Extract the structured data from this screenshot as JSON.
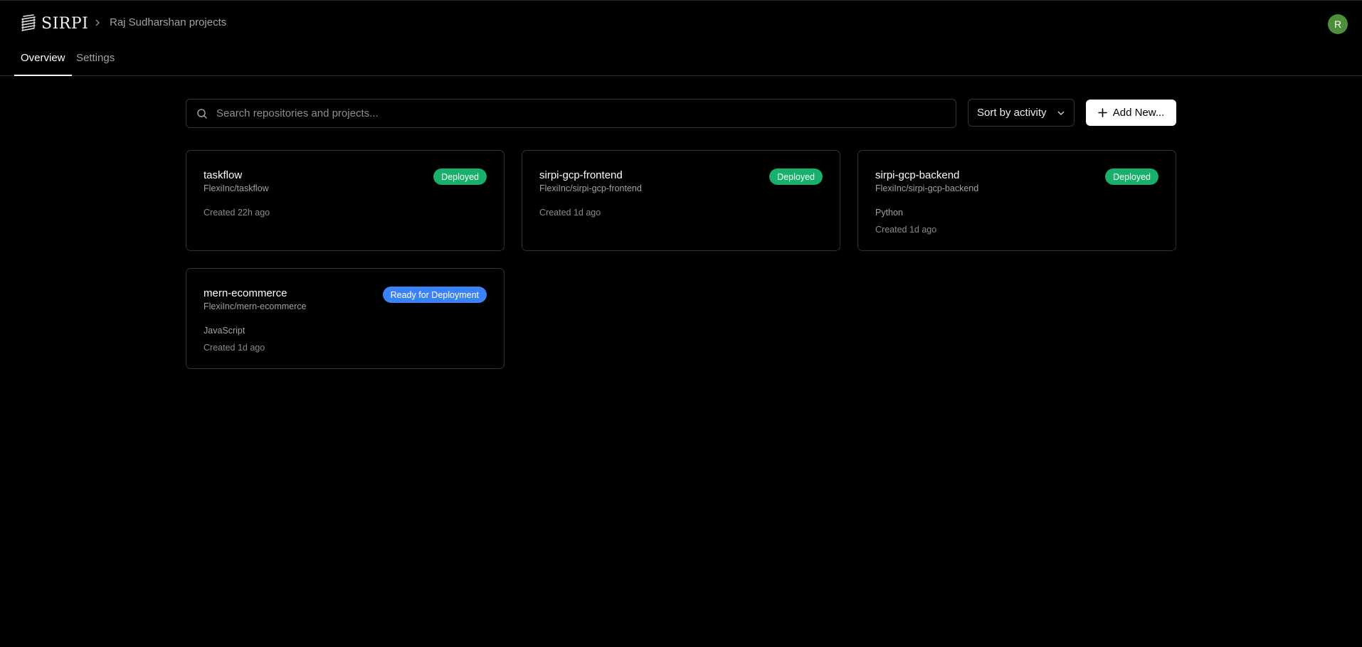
{
  "header": {
    "logo_text": "SIRPI",
    "breadcrumb": "Raj Sudharshan projects",
    "avatar_initial": "R"
  },
  "tabs": [
    {
      "label": "Overview",
      "active": true
    },
    {
      "label": "Settings",
      "active": false
    }
  ],
  "toolbar": {
    "search_placeholder": "Search repositories and projects...",
    "sort_label": "Sort by activity",
    "add_label": "Add New..."
  },
  "colors": {
    "deployed": "#17b16c",
    "ready": "#3b82f6",
    "avatar": "#4d8f3b"
  },
  "projects": [
    {
      "name": "taskflow",
      "repo": "FlexiInc/taskflow",
      "language": "",
      "created": "Created 22h ago",
      "status": "Deployed"
    },
    {
      "name": "sirpi-gcp-frontend",
      "repo": "FlexiInc/sirpi-gcp-frontend",
      "language": "",
      "created": "Created 1d ago",
      "status": "Deployed"
    },
    {
      "name": "sirpi-gcp-backend",
      "repo": "FlexiInc/sirpi-gcp-backend",
      "language": "Python",
      "created": "Created 1d ago",
      "status": "Deployed"
    },
    {
      "name": "mern-ecommerce",
      "repo": "FlexiInc/mern-ecommerce",
      "language": "JavaScript",
      "created": "Created 1d ago",
      "status": "Ready for Deployment"
    }
  ]
}
